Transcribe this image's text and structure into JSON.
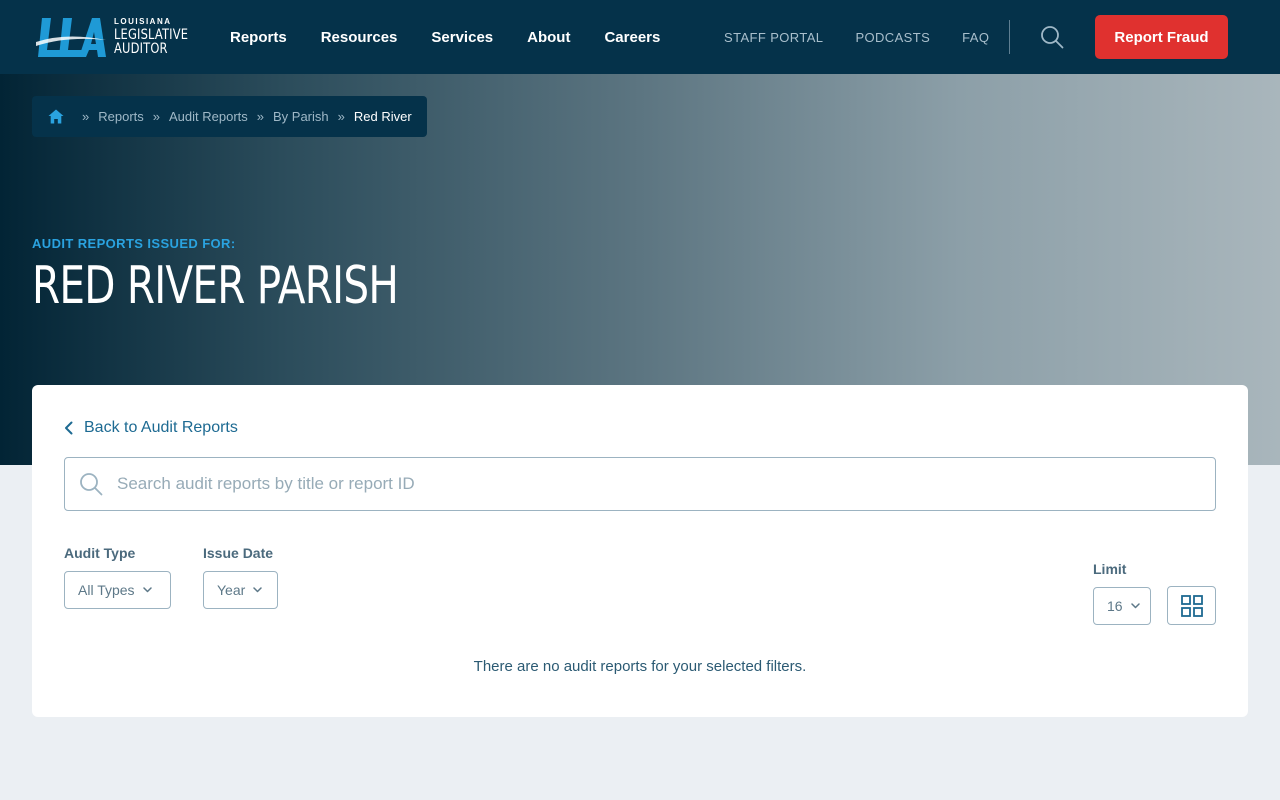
{
  "logo": {
    "small": "LOUISIANA",
    "line1": "LEGISLATIVE",
    "line2": "AUDITOR"
  },
  "main_nav": [
    "Reports",
    "Resources",
    "Services",
    "About",
    "Careers"
  ],
  "util_nav": [
    "STAFF PORTAL",
    "PODCASTS",
    "FAQ"
  ],
  "fraud_button": "Report Fraud",
  "breadcrumb": {
    "items": [
      "Reports",
      "Audit Reports",
      "By Parish"
    ],
    "current": "Red River",
    "separator": "»"
  },
  "hero": {
    "eyebrow": "AUDIT REPORTS ISSUED FOR:",
    "title": "RED RIVER PARISH"
  },
  "card": {
    "back_label": "Back to Audit Reports",
    "search_placeholder": "Search audit reports by title or report ID",
    "filters": {
      "audit_type_label": "Audit Type",
      "audit_type_value": "All Types",
      "issue_date_label": "Issue Date",
      "issue_date_value": "Year",
      "limit_label": "Limit",
      "limit_value": "16"
    },
    "empty_message": "There are no audit reports for your selected filters."
  },
  "colors": {
    "header_bg": "#05324a",
    "accent_blue": "#2aa3e0",
    "fraud_red": "#e0312f",
    "link_blue": "#1d6a92"
  }
}
